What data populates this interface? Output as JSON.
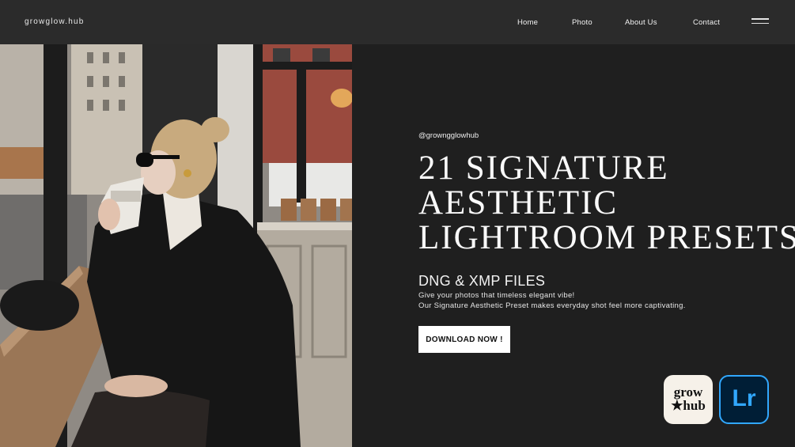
{
  "header": {
    "brand": "growglow.hub",
    "nav": [
      "Home",
      "Photo",
      "About Us",
      "Contact"
    ]
  },
  "hero": {
    "handle": "@growngglowhub",
    "headline": [
      "21 SIGNATURE",
      "AESTHETIC",
      "LIGHTROOM PRESETS"
    ],
    "subtitle": "DNG & XMP FILES",
    "description": [
      "Give your photos that timeless elegant vibe!",
      "Our Signature Aesthetic Preset makes everyday shot feel more captivating."
    ],
    "cta_label": "DOWNLOAD NOW !"
  },
  "logos": {
    "grow_lines": [
      "grow",
      "★hub"
    ],
    "lightroom": "Lr"
  },
  "colors": {
    "background": "#1f1f1f",
    "topbar": "#2b2b2b",
    "lightroom_accent": "#31a8ff",
    "lightroom_bg": "#001e36"
  }
}
